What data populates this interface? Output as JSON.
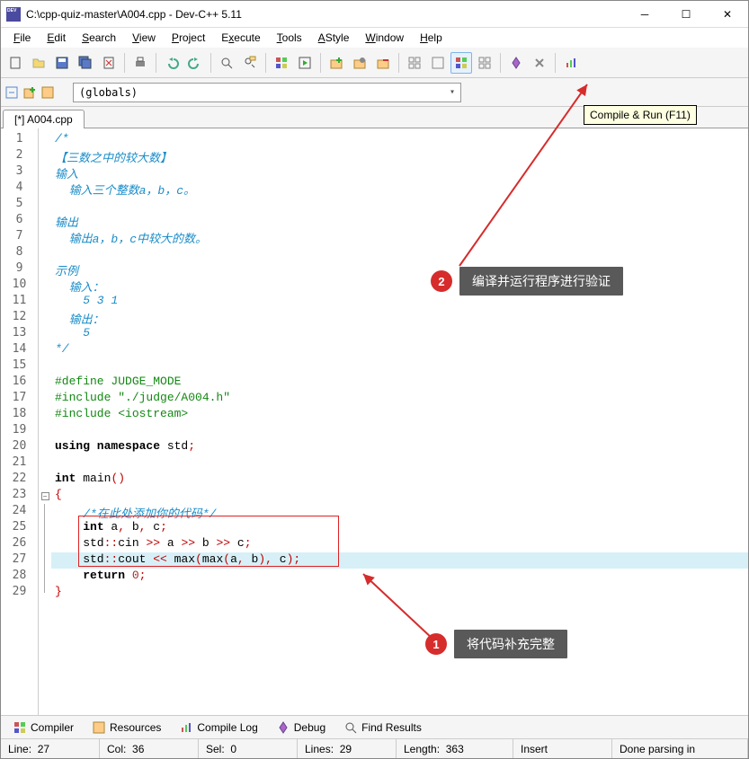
{
  "title": "C:\\cpp-quiz-master\\A004.cpp - Dev-C++ 5.11",
  "menu": {
    "file": "File",
    "edit": "Edit",
    "search": "Search",
    "view": "View",
    "project": "Project",
    "execute": "Execute",
    "tools": "Tools",
    "astyle": "AStyle",
    "window": "Window",
    "help": "Help"
  },
  "globals": "(globals)",
  "tab": "[*] A004.cpp",
  "tooltip": "Compile & Run (F11)",
  "annot1": {
    "num": "1",
    "text": "将代码补充完整"
  },
  "annot2": {
    "num": "2",
    "text": "编译并运行程序进行验证"
  },
  "code_lines": [
    "/*",
    "【三数之中的较大数】",
    "输入",
    "  输入三个整数a，b，c。",
    "",
    "输出",
    "  输出a，b，c中较大的数。",
    "",
    "示例",
    "  输入：",
    "    5 3 1",
    "  输出：",
    "    5",
    "*/",
    "",
    "#define JUDGE_MODE",
    "#include \"./judge/A004.h\"",
    "#include <iostream>",
    "",
    "using namespace std;",
    "",
    "int main()",
    "{",
    "    /*在此处添加你的代码*/",
    "    int a, b, c;",
    "    std::cin >> a >> b >> c;",
    "    std::cout << max(max(a, b), c);",
    "    return 0;",
    "}"
  ],
  "bottom_tabs": {
    "compiler": "Compiler",
    "resources": "Resources",
    "compile_log": "Compile Log",
    "debug": "Debug",
    "find_results": "Find Results"
  },
  "status": {
    "line_lbl": "Line:",
    "line": "27",
    "col_lbl": "Col:",
    "col": "36",
    "sel_lbl": "Sel:",
    "sel": "0",
    "lines_lbl": "Lines:",
    "lines": "29",
    "length_lbl": "Length:",
    "length": "363",
    "insert": "Insert",
    "done": "Done parsing in"
  }
}
